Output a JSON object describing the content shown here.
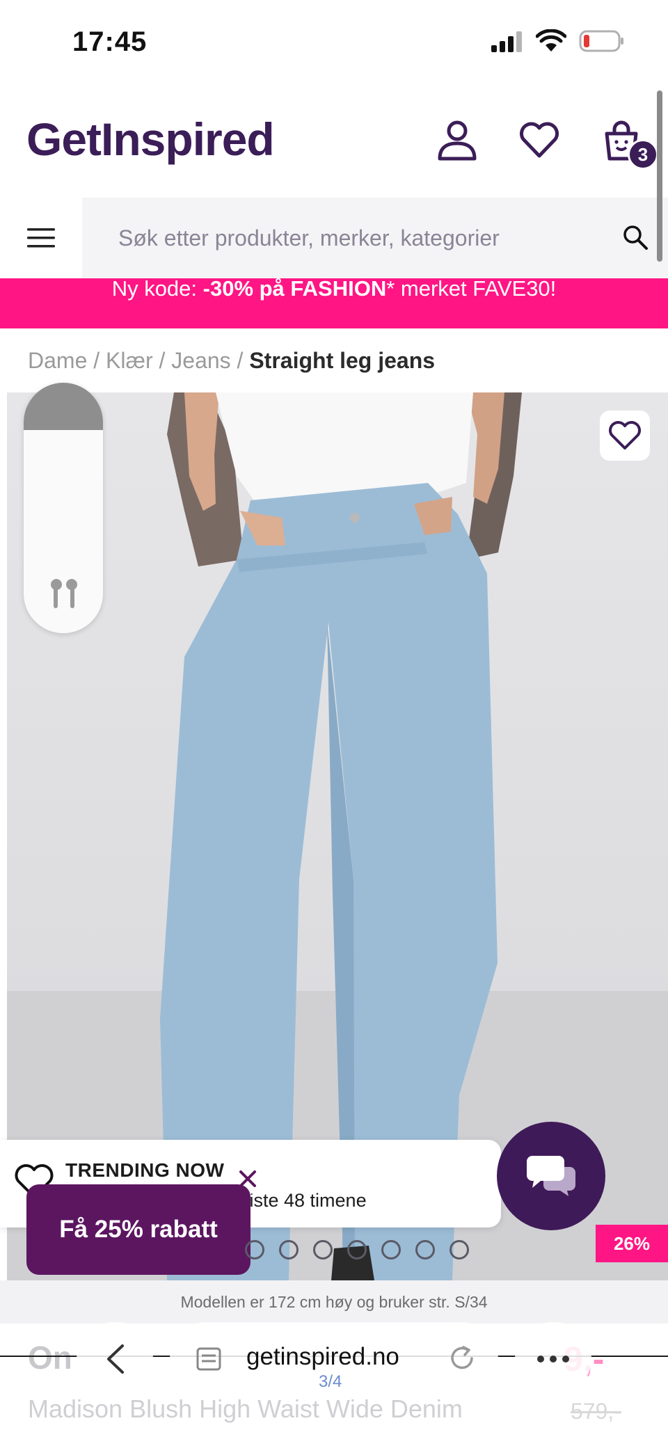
{
  "status_bar": {
    "time": "17:45",
    "battery_color": "#e53935"
  },
  "header": {
    "logo": "GetInspired",
    "cart_count": "3",
    "brand_color": "#3b1d57"
  },
  "search": {
    "placeholder": "Søk etter produkter, merker, kategorier"
  },
  "promo": {
    "prefix": "Ny kode: ",
    "highlight": "-30% på FASHION",
    "suffix": "* merket FAVE30!",
    "color": "#ff1584"
  },
  "breadcrumb": {
    "items": [
      "Dame",
      "Klær",
      "Jeans"
    ],
    "separator": " / ",
    "current": "Straight leg jeans"
  },
  "volume_hud": {
    "level": 0.19
  },
  "trending": {
    "title": "TRENDING NOW",
    "subtitle": "siste 48 timene"
  },
  "discount_button": {
    "label": "Få 25% rabatt",
    "color": "#5c1660"
  },
  "carousel": {
    "dot_count": 7
  },
  "discount_badge": "26%",
  "model_info": "Modellen er 172 cm høy og bruker str. S/34",
  "product": {
    "brand": "On",
    "name": "Madison Blush High Waist Wide Denim",
    "price": "9,-",
    "old_price": "579,-"
  },
  "browser": {
    "url": "getinspired.no",
    "page_indicator": "3/4"
  }
}
